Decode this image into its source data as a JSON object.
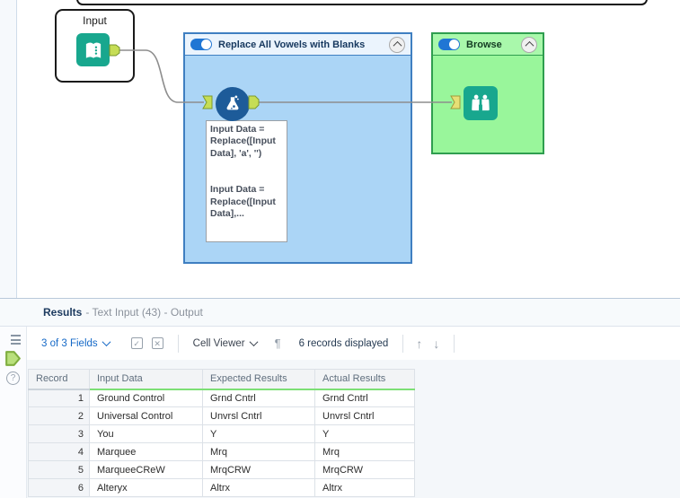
{
  "canvas": {
    "input_tool": {
      "label": "Input"
    },
    "formula_container": {
      "title": "Replace All Vowels with Blanks",
      "annotation": "Input Data =\nReplace([Input\nData], 'a', '')\n\n\nInput Data =\nReplace([Input\nData],..."
    },
    "browse_container": {
      "title": "Browse"
    }
  },
  "results": {
    "title": "Results",
    "subtitle": "- Text Input (43) - Output",
    "toolbar": {
      "fields_label": "3 of 3 Fields",
      "check_icon": "✓",
      "uncheck_icon": "✕",
      "cell_viewer_label": "Cell Viewer",
      "pilcrow": "¶",
      "records_label": "6 records displayed",
      "up_arrow": "↑",
      "down_arrow": "↓"
    },
    "table": {
      "columns": [
        "Record",
        "Input Data",
        "Expected Results",
        "Actual Results"
      ],
      "rows": [
        [
          "1",
          "Ground Control",
          "Grnd Cntrl",
          "Grnd Cntrl"
        ],
        [
          "2",
          "Universal Control",
          "Unvrsl Cntrl",
          "Unvrsl Cntrl"
        ],
        [
          "3",
          "You",
          "Y",
          "Y"
        ],
        [
          "4",
          "Marquee",
          "Mrq",
          "Mrq"
        ],
        [
          "5",
          "MarqueeCReW",
          "MrqCRW",
          "MrqCRW"
        ],
        [
          "6",
          "Alteryx",
          "Altrx",
          "Altrx"
        ]
      ]
    }
  },
  "colors": {
    "container_blue_body": "#abd5f6",
    "container_blue_border": "#3f7fc1",
    "container_green_body": "#99f69b",
    "container_green_border": "#2f9e4f",
    "tool_teal": "#18a78e",
    "formula_navy": "#1d5b99",
    "toggle_blue": "#2076d4",
    "anchor_green": "#c6dd55",
    "anchor_yellow": "#e6df75",
    "wire_gray": "#8d8d8d",
    "table_header_underline": "#7ddf75",
    "link_blue": "#1569c7"
  }
}
